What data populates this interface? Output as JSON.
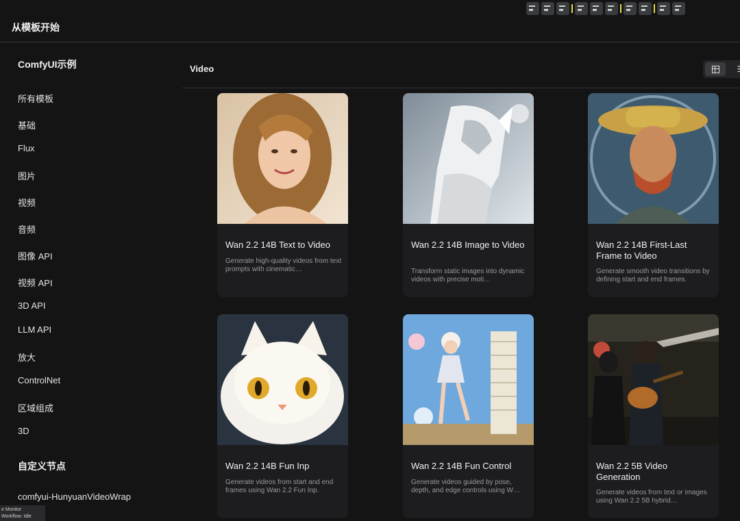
{
  "header": {
    "title": "从模板开始"
  },
  "sidebar": {
    "section_examples": "ComfyUI示例",
    "items": [
      "所有模板",
      "基础",
      "Flux",
      "图片",
      "视频",
      "音频",
      "图像 API",
      "视频 API",
      "3D API",
      "LLM API",
      "放大",
      "ControlNet",
      "区域组成",
      "3D"
    ],
    "section_custom": "自定义节点",
    "custom_items": [
      "comfyui-HunyuanVideoWrapper"
    ]
  },
  "main": {
    "title": "Video",
    "cards": [
      {
        "title": "Wan 2.2 14B Text to Video",
        "desc": "Generate high-quality videos from text prompts with cinematic…"
      },
      {
        "title": "Wan 2.2 14B Image to Video",
        "desc": "Transform static images into dynamic videos with precise moti…"
      },
      {
        "title": "Wan 2.2 14B First-Last Frame to Video",
        "desc": "Generate smooth video transitions by defining start and end frames."
      },
      {
        "title": "Wan 2.2 14B Fun Inp",
        "desc": "Generate videos from start and end frames using Wan 2.2 Fun Inp."
      },
      {
        "title": "Wan 2.2 14B Fun Control",
        "desc": "Generate videos guided by pose, depth, and edge controls using W…"
      },
      {
        "title": "Wan 2.2 5B Video Generation",
        "desc": "Generate videos from text or images using Wan 2.2 5B hybrid…"
      }
    ]
  },
  "status": {
    "line1": "e Monitor",
    "line2": "Workflow: Idle"
  },
  "colors": {
    "background": "#141415",
    "card": "#1d1d20",
    "accent_yellow": "#e6d84a"
  }
}
